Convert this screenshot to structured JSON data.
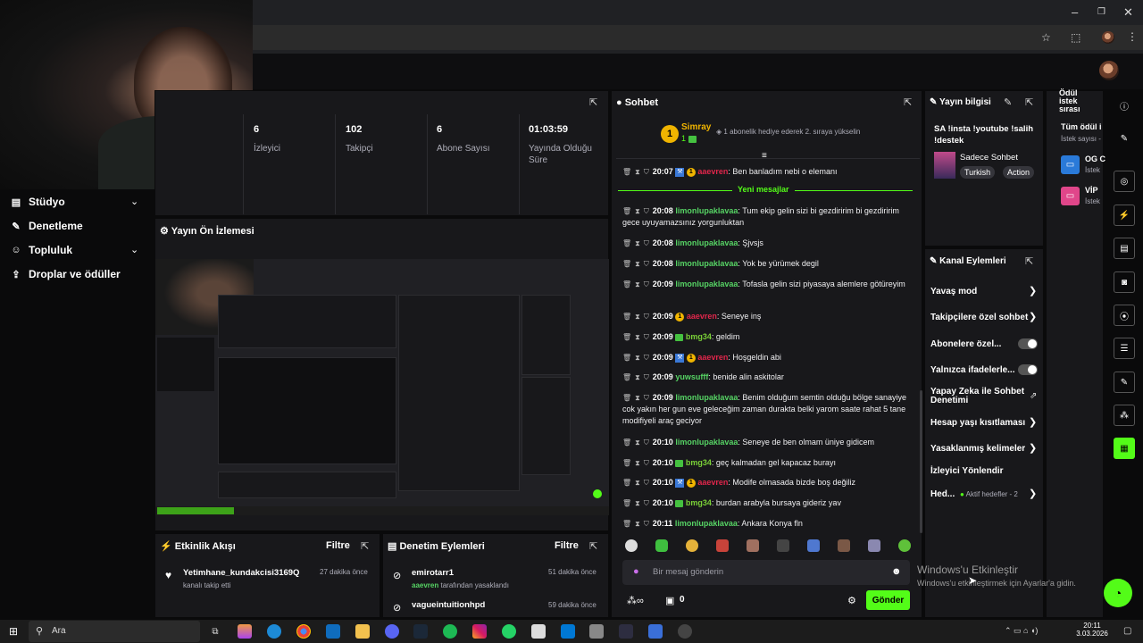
{
  "nav": {
    "studio": "Stüdyo",
    "moderation": "Denetleme",
    "community": "Topluluk",
    "drops": "Droplar ve ödüller"
  },
  "stats": [
    {
      "value": "6",
      "label": "İzleyici"
    },
    {
      "value": "102",
      "label": "Takipçi"
    },
    {
      "value": "6",
      "label": "Abone Sayısı"
    },
    {
      "value": "01:03:59",
      "label": "Yayında Olduğu Süre"
    }
  ],
  "preview": {
    "title": "Yayın Ön İzlemesi"
  },
  "activity": {
    "title": "Etkinlik Akışı",
    "filter": "Filtre",
    "items": [
      {
        "user": "Yetimhane_kundakcisi3169Q",
        "time": "27 dakika önce",
        "text": "kanalı takip etti"
      }
    ]
  },
  "modactions": {
    "title": "Denetim Eylemleri",
    "filter": "Filtre",
    "items": [
      {
        "user": "emirotarr1",
        "time": "51 dakika önce",
        "by": "aaevren",
        "text": "tarafından yasaklandı"
      },
      {
        "user": "vagueintuitionhpd",
        "time": "59 dakika önce"
      }
    ]
  },
  "chat": {
    "title": "Sohbet",
    "pinned_user": "Simray",
    "pinned_count": "1",
    "pinned_text": "1 abonelik hediye ederek 2. sıraya yükselin",
    "new_messages": "Yeni mesajlar",
    "messages": [
      {
        "time": "20:07",
        "user": "aaevren",
        "text": ": Ben banladım nebi o elemanı"
      },
      {
        "time": "20:08",
        "user": "limonlupaklavaa",
        "text": ": Tum ekip gelin sizi bi gezdiririm bi gezdiririm gece uyuyamazsınız yorgunluktan"
      },
      {
        "time": "20:08",
        "user": "limonlupaklavaa",
        "text": ": Şjvsjs"
      },
      {
        "time": "20:08",
        "user": "limonlupaklavaa",
        "text": ": Yok be yürümek degil"
      },
      {
        "time": "20:09",
        "user": "limonlupaklavaa",
        "text": ": Tofasla gelin sizi piyasaya alemlere götüreyim"
      },
      {
        "time": "20:09",
        "user": "aaevren",
        "text": ": Seneye inş"
      },
      {
        "time": "20:09",
        "user": "bmg34",
        "text": ": geldim"
      },
      {
        "time": "20:09",
        "user": "aaevren",
        "text": ": Hoşgeldin abi"
      },
      {
        "time": "20:09",
        "user": "yuwsufff",
        "text": ": benide alin askitolar"
      },
      {
        "time": "20:09",
        "user": "limonlupaklavaa",
        "text": ": Benim olduğum semtin olduğu bölge sanayiye cok yakın her gun eve geleceğim zaman durakta belki yarom saate rahat 5 tane modifiyeli araç geciyor"
      },
      {
        "time": "20:10",
        "user": "limonlupaklavaa",
        "text": ": Seneye de ben olmam üniye gidicem"
      },
      {
        "time": "20:10",
        "user": "bmg34",
        "text": ": geç kalmadan gel kapacaz burayı"
      },
      {
        "time": "20:10",
        "user": "aaevren",
        "text": ": Modife olmasada bizde boş değiliz"
      },
      {
        "time": "20:10",
        "user": "bmg34",
        "text": ": burdan arabyla bursaya gideriz yav"
      },
      {
        "time": "20:11",
        "user": "limonlupaklavaa",
        "text": ": Ankara Konya fln"
      }
    ],
    "input_placeholder": "Bir mesaj gönderin",
    "points": "0",
    "send": "Gönder"
  },
  "streaminfo": {
    "title": "Yayın bilgisi",
    "stream_title": "SA !insta !youtube !salih !destek",
    "category": "Sadece Sohbet",
    "tags": [
      "Turkish",
      "Action"
    ]
  },
  "channelactions": {
    "title": "Kanal Eylemleri",
    "items": [
      "Yavaş mod",
      "Takipçilere özel sohbet",
      "Abonelere özel...",
      "Yalnızca ifadelerle...",
      "Yapay Zeka ile Sohbet Denetimi",
      "Hesap yaşı kısıtlaması",
      "Yasaklanmış kelimeler",
      "İzleyici Yönlendir",
      "Hed..."
    ],
    "active_goals": "Aktif hedefler - 2"
  },
  "rewards": {
    "title": "Ödül istek sırası",
    "all": "Tüm ödül i",
    "count": "İstek sayısı -",
    "items": [
      {
        "name": "OG C",
        "sub": "İstek"
      },
      {
        "name": "VİP",
        "sub": "İstek"
      }
    ]
  },
  "windows": {
    "activate_title": "Windows'u Etkinleştir",
    "activate_sub": "Windows'u etkinleştirmek için Ayarlar'a gidin."
  },
  "taskbar": {
    "search": "Ara",
    "time": "20:11",
    "date": "3.03.2026"
  },
  "colors": {
    "accent": "#53fc18",
    "mod_red": "#e0264b",
    "user_green": "#56d364"
  }
}
